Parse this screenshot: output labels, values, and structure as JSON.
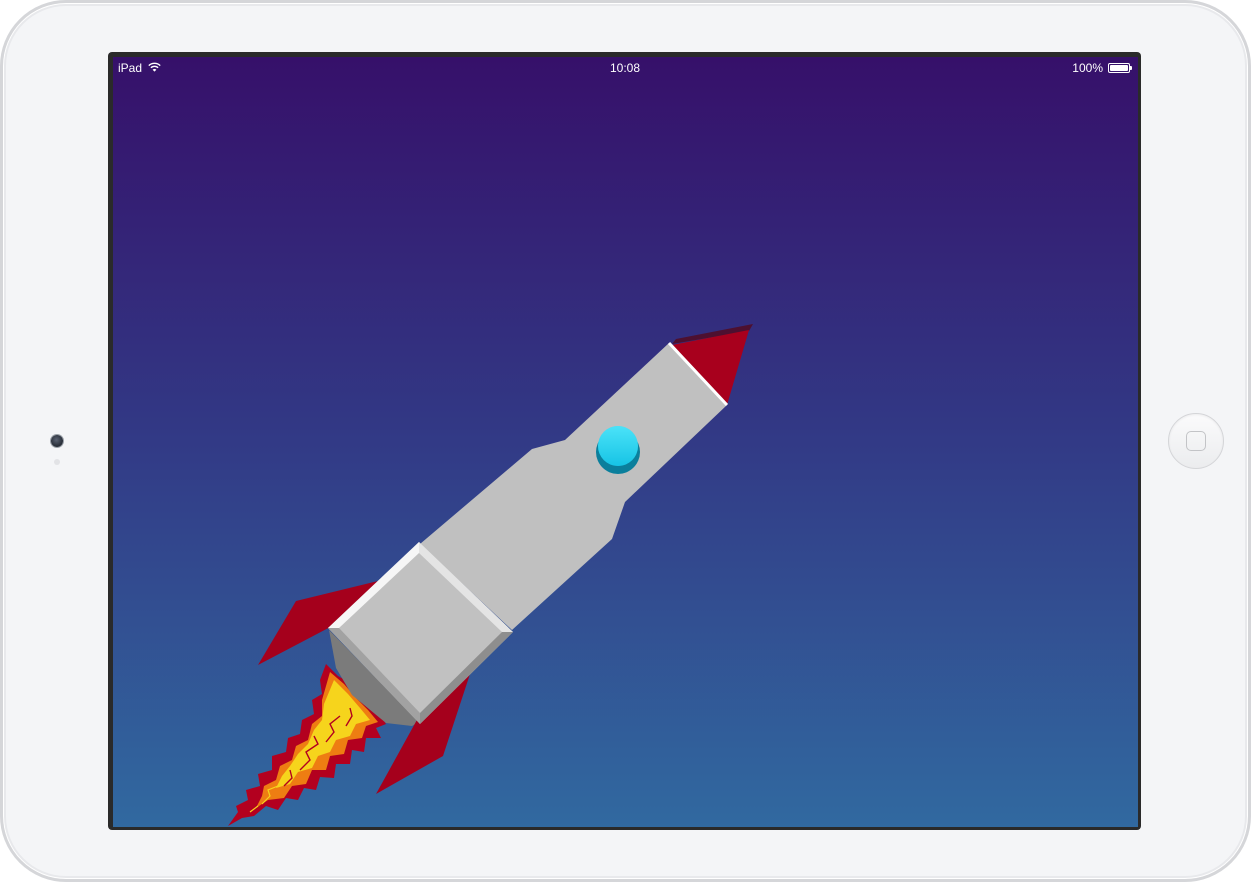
{
  "status_bar": {
    "carrier": "iPad",
    "wifi_icon": "wifi-icon",
    "time": "10:08",
    "battery_percent": "100%",
    "battery_icon": "battery-icon",
    "battery_level": 1.0
  },
  "device": {
    "camera_icon": "camera-icon",
    "home_button_icon": "home-button-icon"
  },
  "screen": {
    "background_top": "#36106a",
    "background_mid": "#323a86",
    "background_bottom": "#3169a0"
  },
  "rocket": {
    "icon": "rocket-icon",
    "body_color": "#c0c0c0",
    "fin_color": "#a5001c",
    "nose_color": "#a8001d",
    "porthole_color": "#1fd2f0",
    "flame_colors": [
      "#b3001f",
      "#ee7d12",
      "#f6d41c"
    ]
  }
}
